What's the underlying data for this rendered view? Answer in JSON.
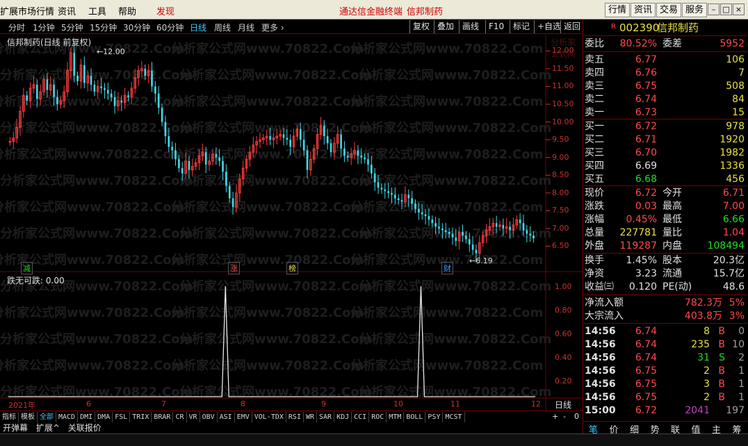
{
  "menubar": {
    "items": [
      "扩展市场行情",
      "资讯",
      "工具",
      "帮助"
    ],
    "discover": "发现",
    "center_title": "通达信金融终端",
    "center_stock": "信邦制药",
    "right_buttons": [
      "行情",
      "资讯",
      "交易",
      "服务"
    ],
    "window_buttons": [
      "–",
      "□",
      "×"
    ]
  },
  "period_bar": {
    "items": [
      "分时",
      "1分钟",
      "5分钟",
      "15分钟",
      "30分钟",
      "60分钟",
      "日线",
      "周线",
      "月线",
      "更多 ›"
    ],
    "active": "日线",
    "tools": [
      "复权",
      "叠加",
      "画线",
      "F10",
      "标记",
      "+自选",
      "返回"
    ]
  },
  "chart": {
    "title": "信邦制药(日线 前复权)",
    "price_labels": [
      "12.00",
      "11.50",
      "11.00",
      "10.50",
      "10.00",
      "9.50",
      "9.00",
      "8.50",
      "8.00",
      "7.50",
      "7.00",
      "6.50"
    ],
    "max_label": "12.00",
    "min_label": "6.19",
    "event_marks": [
      {
        "text": "减",
        "color": "#22dd22"
      },
      {
        "text": "涨",
        "color": "#ff4a4a"
      },
      {
        "text": "榜",
        "color": "#e8e040"
      },
      {
        "text": "财",
        "color": "#40a0ff"
      }
    ],
    "watermark": "分析家公式网www.70822.Com",
    "corner_watermark": "分析家公式网"
  },
  "chart_data": {
    "type": "candlestick",
    "title": "信邦制药(日线 前复权)",
    "ylim": [
      6.0,
      12.3
    ],
    "max": 12.0,
    "min": 6.19,
    "x_labels": [
      "2021年",
      "6",
      "7",
      "8",
      "9",
      "10",
      "11",
      "12"
    ],
    "close": [
      9.45,
      9.55,
      9.85,
      10.3,
      10.75,
      10.6,
      10.95,
      11.05,
      10.65,
      10.85,
      11.2,
      10.9,
      11.05,
      10.7,
      10.5,
      10.6,
      10.85,
      11.45,
      11.95,
      11.3,
      11.15,
      11.6,
      11.1,
      11.3,
      11.05,
      10.85,
      11.0,
      10.95,
      10.9,
      10.8,
      10.7,
      10.45,
      10.6,
      10.55,
      10.75,
      10.7,
      10.95,
      11.25,
      11.45,
      11.5,
      11.3,
      11.45,
      11.0,
      10.8,
      10.4,
      10.0,
      9.6,
      9.3,
      9.2,
      8.95,
      8.7,
      8.55,
      8.9,
      8.65,
      8.75,
      8.85,
      9.05,
      9.15,
      8.8,
      8.9,
      9.1,
      9.0,
      8.9,
      8.6,
      8.2,
      7.85,
      7.6,
      8.0,
      8.4,
      8.7,
      8.95,
      9.15,
      9.35,
      9.45,
      9.5,
      9.55,
      9.6,
      9.5,
      9.55,
      9.6,
      9.65,
      9.55,
      9.5,
      9.3,
      9.6,
      9.8,
      9.5,
      9.2,
      8.65,
      8.95,
      9.25,
      9.65,
      9.9,
      9.6,
      9.4,
      9.15,
      9.4,
      9.65,
      9.25,
      9.05,
      9.0,
      9.1,
      9.2,
      9.05,
      9.0,
      8.95,
      8.8,
      8.55,
      8.3,
      8.15,
      8.1,
      8.05,
      8.0,
      7.95,
      7.85,
      7.8,
      7.75,
      7.95,
      7.85,
      7.7,
      7.55,
      7.45,
      7.4,
      7.35,
      7.25,
      7.15,
      7.05,
      7.0,
      6.95,
      6.9,
      6.85,
      6.75,
      6.65,
      6.9,
      6.8,
      6.7,
      6.55,
      6.4,
      6.3,
      6.6,
      6.8,
      6.95,
      7.05,
      7.15,
      7.05,
      7.1,
      7.0,
      7.05,
      6.95,
      7.1,
      7.25,
      7.15,
      6.95,
      6.85,
      6.8,
      6.72
    ],
    "series_name": "跌无可跌",
    "series_value_label": "0.00",
    "indicator_ticks": [
      "1.00",
      "0.80",
      "0.60",
      "0.40",
      "0.20"
    ],
    "signal_positions": [
      0.412,
      0.783
    ],
    "indicator_ylim": [
      0,
      1.0
    ]
  },
  "indicator": {
    "label": "跌无可跌",
    "value": ": 0.00"
  },
  "tabbar": {
    "tabs": [
      "指标",
      "模板",
      "全部",
      "MACD",
      "DMI",
      "DMA",
      "FSL",
      "TRIX",
      "BRAR",
      "CR",
      "VR",
      "OBV",
      "ASI",
      "EMV",
      "VOL-TDX",
      "RSI",
      "WR",
      "SAR",
      "KDJ",
      "CCI",
      "ROC",
      "MTM",
      "BOLL",
      "PSY",
      "MCST"
    ],
    "active": "全部",
    "row2": [
      "开弹幕",
      "扩展^",
      "关联报价"
    ],
    "period_label": "日线",
    "zoom": [
      "+",
      "-",
      "0"
    ]
  },
  "quote": {
    "badge": "R",
    "code": "002390",
    "name": "信邦制药",
    "weibi_label": "委比",
    "weibi": "80.52%",
    "weicha_label": "委差",
    "weicha": "5952",
    "sell": [
      {
        "label": "卖五",
        "price": "6.77",
        "vol": "106"
      },
      {
        "label": "卖四",
        "price": "6.76",
        "vol": "7"
      },
      {
        "label": "卖三",
        "price": "6.75",
        "vol": "508"
      },
      {
        "label": "卖二",
        "price": "6.74",
        "vol": "84"
      },
      {
        "label": "卖一",
        "price": "6.73",
        "vol": "15"
      }
    ],
    "buy": [
      {
        "label": "买一",
        "price": "6.72",
        "vol": "978"
      },
      {
        "label": "买二",
        "price": "6.71",
        "vol": "1920"
      },
      {
        "label": "买三",
        "price": "6.70",
        "vol": "1982"
      },
      {
        "label": "买四",
        "price": "6.69",
        "vol": "1336"
      },
      {
        "label": "买五",
        "price": "6.68",
        "vol": "456"
      }
    ],
    "stats": [
      {
        "l1": "现价",
        "v1": "6.72",
        "l2": "今开",
        "v2": "6.71"
      },
      {
        "l1": "涨跌",
        "v1": "0.03",
        "l2": "最高",
        "v2": "7.00"
      },
      {
        "l1": "涨幅",
        "v1": "0.45%",
        "l2": "最低",
        "v2": "6.66"
      },
      {
        "l1": "总量",
        "v1": "227781",
        "l2": "量比",
        "v2": "1.04"
      },
      {
        "l1": "外盘",
        "v1": "119287",
        "l2": "内盘",
        "v2": "108494"
      }
    ],
    "fund": [
      {
        "l1": "换手",
        "v1": "1.45%",
        "l2": "股本",
        "v2": "20.3亿"
      },
      {
        "l1": "净资",
        "v1": "3.23",
        "l2": "流通",
        "v2": "15.7亿"
      },
      {
        "l1": "收益㈢",
        "v1": "0.120",
        "l2": "PE(动)",
        "v2": "48.6"
      }
    ],
    "flow": [
      {
        "label": "净流入额",
        "value": "782.3万",
        "pct": "5%"
      },
      {
        "label": "大宗流入",
        "value": "403.8万",
        "pct": "3%"
      }
    ],
    "ticks": [
      {
        "time": "14:56",
        "price": "6.74",
        "vol": "8",
        "side": "B",
        "n": "0"
      },
      {
        "time": "14:56",
        "price": "6.74",
        "vol": "235",
        "side": "B",
        "n": "10"
      },
      {
        "time": "14:56",
        "price": "6.74",
        "vol": "31",
        "side": "S",
        "n": "2"
      },
      {
        "time": "14:56",
        "price": "6.75",
        "vol": "2",
        "side": "B",
        "n": "1"
      },
      {
        "time": "14:56",
        "price": "6.75",
        "vol": "3",
        "side": "B",
        "n": "1"
      },
      {
        "time": "14:56",
        "price": "6.75",
        "vol": "2",
        "side": "B",
        "n": "1"
      },
      {
        "time": "15:00",
        "price": "6.72",
        "vol": "2041",
        "side": "",
        "n": "197"
      }
    ],
    "bottom_tabs": [
      "笔",
      "价",
      "细",
      "势",
      "联",
      "值",
      "主",
      "筹"
    ]
  }
}
